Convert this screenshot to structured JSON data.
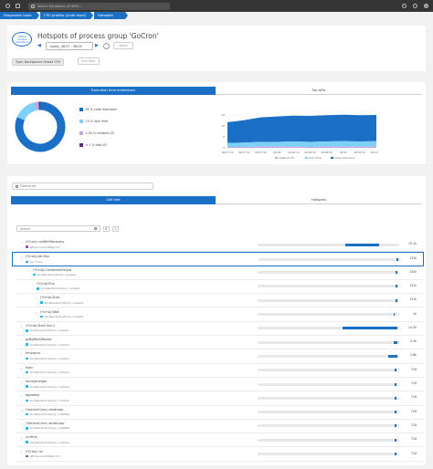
{
  "topbar": {
    "search_placeholder": "Search Dynatrace (k74935..."
  },
  "breadcrumbs": [
    {
      "label": "Diagnostic tools"
    },
    {
      "label": "CPU profiler (code level)"
    },
    {
      "label": "Hotspots"
    }
  ],
  "header": {
    "logo_text": "ratable process operations",
    "title": "Hotspots of process group 'GoCron'",
    "timeframe": "today, 08:07 - 08:09",
    "apply_label": "Apply",
    "filter_chip": "Type: Background thread CPU",
    "add_filter_label": "Add filter"
  },
  "breakdown": {
    "tabs": [
      {
        "label": "Execution time breakdown"
      },
      {
        "label": "Top APIs"
      }
    ],
    "donut_legend": [
      {
        "label": "81 % code execution",
        "color": "#1b70c6",
        "pct": 81
      },
      {
        "label": "15 % lock time",
        "color": "#7fd0f7",
        "pct": 15
      },
      {
        "label": "2.55 % network I/O",
        "color": "#c3a5e0",
        "pct": 2.55
      },
      {
        "label": "< 1 % disk I/O",
        "color": "#5a2c8c",
        "pct": 1
      }
    ]
  },
  "chart_data": {
    "type": "area",
    "x": [
      "08:07:15",
      "08:07:30",
      "08:07:45",
      "08:08",
      "08:08:15",
      "08:08:30",
      "08:08:45",
      "08:09",
      "08:09:15",
      "08:09:30"
    ],
    "ylim": [
      0,
      20
    ],
    "yticks": [
      "15",
      "10",
      "5",
      "0"
    ],
    "series": [
      {
        "name": "network I/O",
        "color": "#c3a5e0",
        "values": [
          0.4,
          0.4,
          0.5,
          0.5,
          0.5,
          0.4,
          0.5,
          0.5,
          0.5,
          0.5
        ]
      },
      {
        "name": "lock time",
        "color": "#7fd0f7",
        "values": [
          1.8,
          2.0,
          2.2,
          2.2,
          2.4,
          2.3,
          2.4,
          2.5,
          2.4,
          2.5
        ]
      },
      {
        "name": "code execution",
        "color": "#1b70c6",
        "values": [
          9.5,
          10.2,
          11.2,
          11.6,
          11.8,
          11.9,
          12.0,
          12.1,
          12.0,
          12.0
        ]
      }
    ],
    "xlabel": "",
    "ylabel": ""
  },
  "calltree": {
    "filter_placeholder": "Filtered by",
    "tabs": [
      {
        "label": "Call tree"
      },
      {
        "label": "Hotspots"
      }
    ],
    "search_placeholder": "Search",
    "rows": [
      {
        "name": "(*Cron).runWithRecovery",
        "sub": "github.com/robfig/cron",
        "pkg": true,
        "indent": 0,
        "pct": 0.86,
        "base": 0.62,
        "value": "15.1k"
      },
      {
        "name": "(*Cron).Job.Run",
        "sub": "Go / main",
        "pkg": false,
        "indent": 1,
        "pct": 0.99,
        "base": 0.975,
        "value": "132k"
      },
      {
        "name": "(*Cmd).CombinedOutput",
        "sub": "Go Standard Library / os/exec",
        "pkg": false,
        "indent": 2,
        "pct": 0.99,
        "base": 0.975,
        "value": "132k"
      },
      {
        "name": "(*Cmd).Run",
        "sub": "Go Standard Library / os/exec",
        "pkg": false,
        "indent": 3,
        "pct": 0.99,
        "base": 0.975,
        "value": "131k"
      },
      {
        "name": "(*Cmd).Start",
        "sub": "Go Standard Library / os/exec",
        "pkg": false,
        "indent": 4,
        "pct": 0.99,
        "base": 0.975,
        "value": "131k"
      },
      {
        "name": "(*Cmd).Wait",
        "sub": "Go Standard Library / os/exec",
        "pkg": false,
        "indent": 4,
        "pct": 0.97,
        "base": 0.96,
        "value": "1k"
      },
      {
        "name": "(*Cmd).Start.func1",
        "sub": "Go Standard Library / os/exec",
        "pkg": false,
        "indent": 0,
        "pct": 0.99,
        "base": 0.6,
        "value": "14.3k"
      },
      {
        "name": "gcBgMarkWorker",
        "sub": "Go Standard Library / runtime",
        "pkg": false,
        "indent": 0,
        "pct": 0.99,
        "base": 0.96,
        "value": "4.3k"
      },
      {
        "name": "timerproc",
        "sub": "Go Standard Library / runtime",
        "pkg": false,
        "indent": 0,
        "pct": 0.99,
        "base": 0.92,
        "value": "2.8k"
      },
      {
        "name": "main",
        "sub": "Go Standard Library / runtime",
        "pkg": false,
        "indent": 0,
        "pct": 0.98,
        "base": 0.97,
        "value": "718"
      },
      {
        "name": "forcegchelper",
        "sub": "Go Standard Library / runtime",
        "pkg": false,
        "indent": 0,
        "pct": 0.98,
        "base": 0.97,
        "value": "718"
      },
      {
        "name": "bgsweep",
        "sub": "Go Standard Library / runtime",
        "pkg": false,
        "indent": 0,
        "pct": 0.98,
        "base": 0.97,
        "value": "718"
      },
      {
        "name": "(*persistConn).readLoop",
        "sub": "Go Standard Library / net/http",
        "pkg": false,
        "indent": 0,
        "pct": 0.98,
        "base": 0.97,
        "value": "718"
      },
      {
        "name": "(*persistConn).writeLoop",
        "sub": "Go Standard Library / net/http",
        "pkg": false,
        "indent": 0,
        "pct": 0.98,
        "base": 0.97,
        "value": "718"
      },
      {
        "name": "runFinq",
        "sub": "Go Standard Library / runtime",
        "pkg": false,
        "indent": 0,
        "pct": 0.98,
        "base": 0.97,
        "value": "718"
      },
      {
        "name": "(*Cron).run",
        "sub": "github.com/robfig/cron",
        "pkg": true,
        "indent": 0,
        "pct": 0.98,
        "base": 0.97,
        "value": "718"
      }
    ]
  }
}
